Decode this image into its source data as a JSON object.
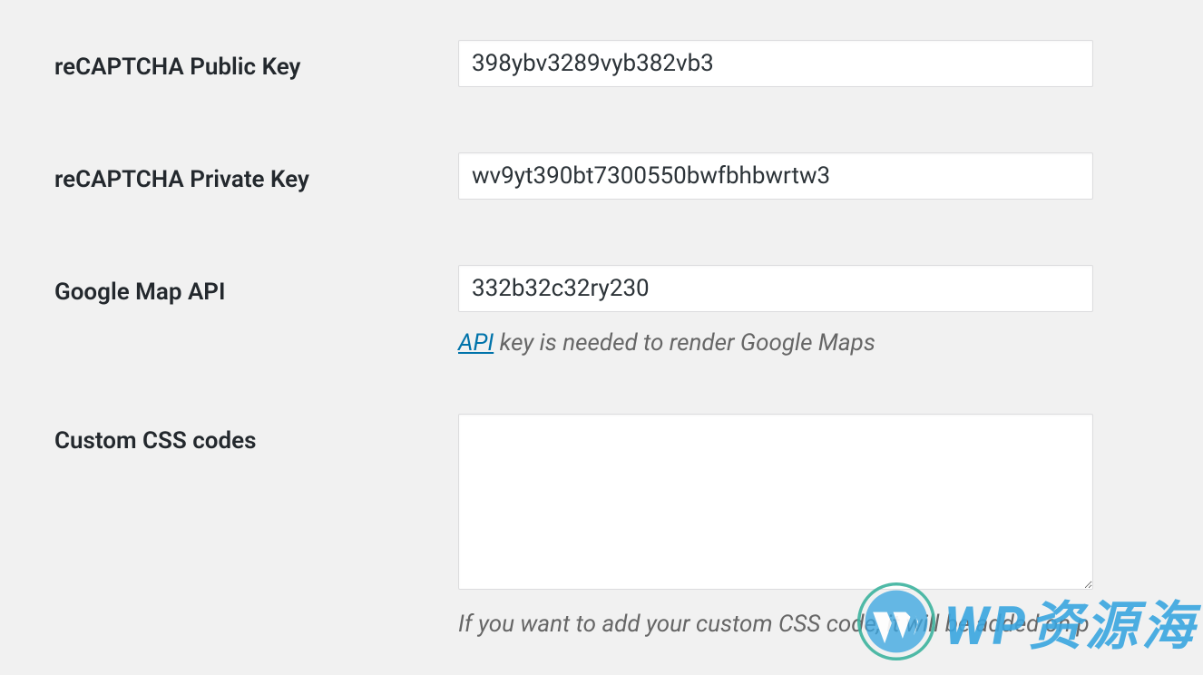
{
  "fields": {
    "recaptcha_public": {
      "label": "reCAPTCHA Public Key",
      "value": "398ybv3289vyb382vb3"
    },
    "recaptcha_private": {
      "label": "reCAPTCHA Private Key",
      "value": "wv9yt390bt7300550bwfbhbwrtw3"
    },
    "google_map_api": {
      "label": "Google Map API",
      "value": "332b32c32ry230",
      "help_link": "API",
      "help_rest": " key is needed to render Google Maps"
    },
    "custom_css": {
      "label": "Custom CSS codes",
      "value": "",
      "help": "If you want to add your custom CSS code, it will be added on p"
    }
  },
  "watermark": {
    "text": "WP资源海"
  }
}
